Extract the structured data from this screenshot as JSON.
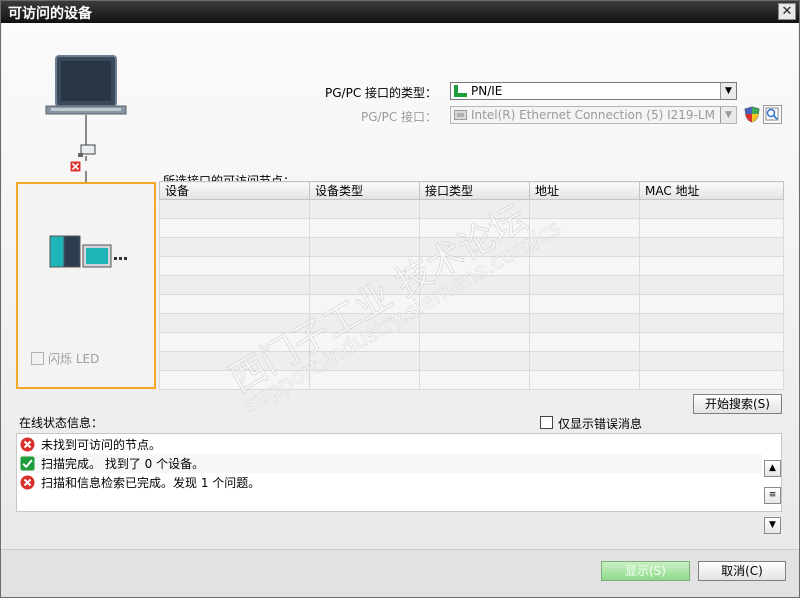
{
  "window": {
    "title": "可访问的设备",
    "close_symbol": "✕"
  },
  "interface": {
    "type_label": "PG/PC 接口的类型：",
    "type_value": "PN/IE",
    "port_label": "PG/PC 接口：",
    "port_value": "Intel(R) Ethernet Connection (5) I219-LM"
  },
  "nodes": {
    "label": "所选接口的可访问节点：",
    "columns": [
      "设备",
      "设备类型",
      "接口类型",
      "地址",
      "MAC 地址"
    ]
  },
  "flash_led": {
    "label": "闪烁 LED"
  },
  "search_button": "开始搜索(S)",
  "online_status": {
    "label": "在线状态信息：",
    "only_errors_label": "仅显示错误消息",
    "messages": [
      {
        "icon": "error-icon",
        "text": "未找到可访问的节点。"
      },
      {
        "icon": "success-icon",
        "text": "扫描完成。 找到了 0 个设备。"
      },
      {
        "icon": "error-icon",
        "text": "扫描和信息检索已完成。发现 1 个问题。"
      }
    ]
  },
  "footer": {
    "display_button": "显示(S)",
    "cancel_button": "取消(C)"
  },
  "watermark": {
    "line1": "西门子工业 技术论坛",
    "line2": "support.industry.siemens.com/cs"
  },
  "colors": {
    "highlight": "#f5a623",
    "error": "#d9302c",
    "success": "#1e9e3a"
  }
}
